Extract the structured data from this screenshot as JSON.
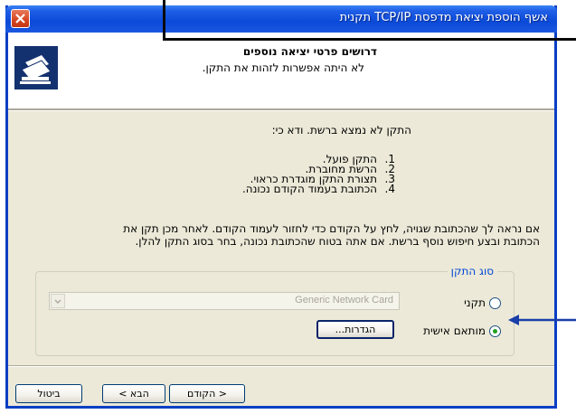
{
  "window": {
    "title": "אשף הוספת יציאת מדפסת TCP/IP תקנית"
  },
  "header": {
    "title": "דרושים פרטי יציאה נוספים",
    "subtitle": "לא היתה אפשרות לזהות את התקן."
  },
  "body": {
    "intro": "התקן לא נמצא ברשת. ודא כי:",
    "checklist": [
      {
        "num": "1.",
        "text": "התקן פועל."
      },
      {
        "num": "2.",
        "text": "הרשת מחוברת."
      },
      {
        "num": "3.",
        "text": "תצורת התקן מוגדרת כראוי."
      },
      {
        "num": "4.",
        "text": "הכתובת בעמוד הקודם נכונה."
      }
    ],
    "para_line1": "אם נראה לך שהכתובת שגויה, לחץ על הקודם כדי לחזור לעמוד הקודם. לאחר מכן תקן את",
    "para_line2": "הכתובת ובצע חיפוש נוסף ברשת. אם אתה בטוח שהכתובת נכונה, בחר בסוג התקן להלן."
  },
  "device_type": {
    "legend": "סוג התקן",
    "standard_label": "תקני",
    "standard_value": "Generic Network Card",
    "custom_label": "מותאם אישית",
    "settings_button": "הגדרות...",
    "selected": "custom"
  },
  "footer": {
    "next_label": "הבא >",
    "back_label": "< הקודם",
    "cancel_label": "ביטול"
  },
  "colors": {
    "titlebar": "#0b4ad8",
    "dialog_bg": "#ece9d8",
    "legend_text": "#0046d5"
  }
}
